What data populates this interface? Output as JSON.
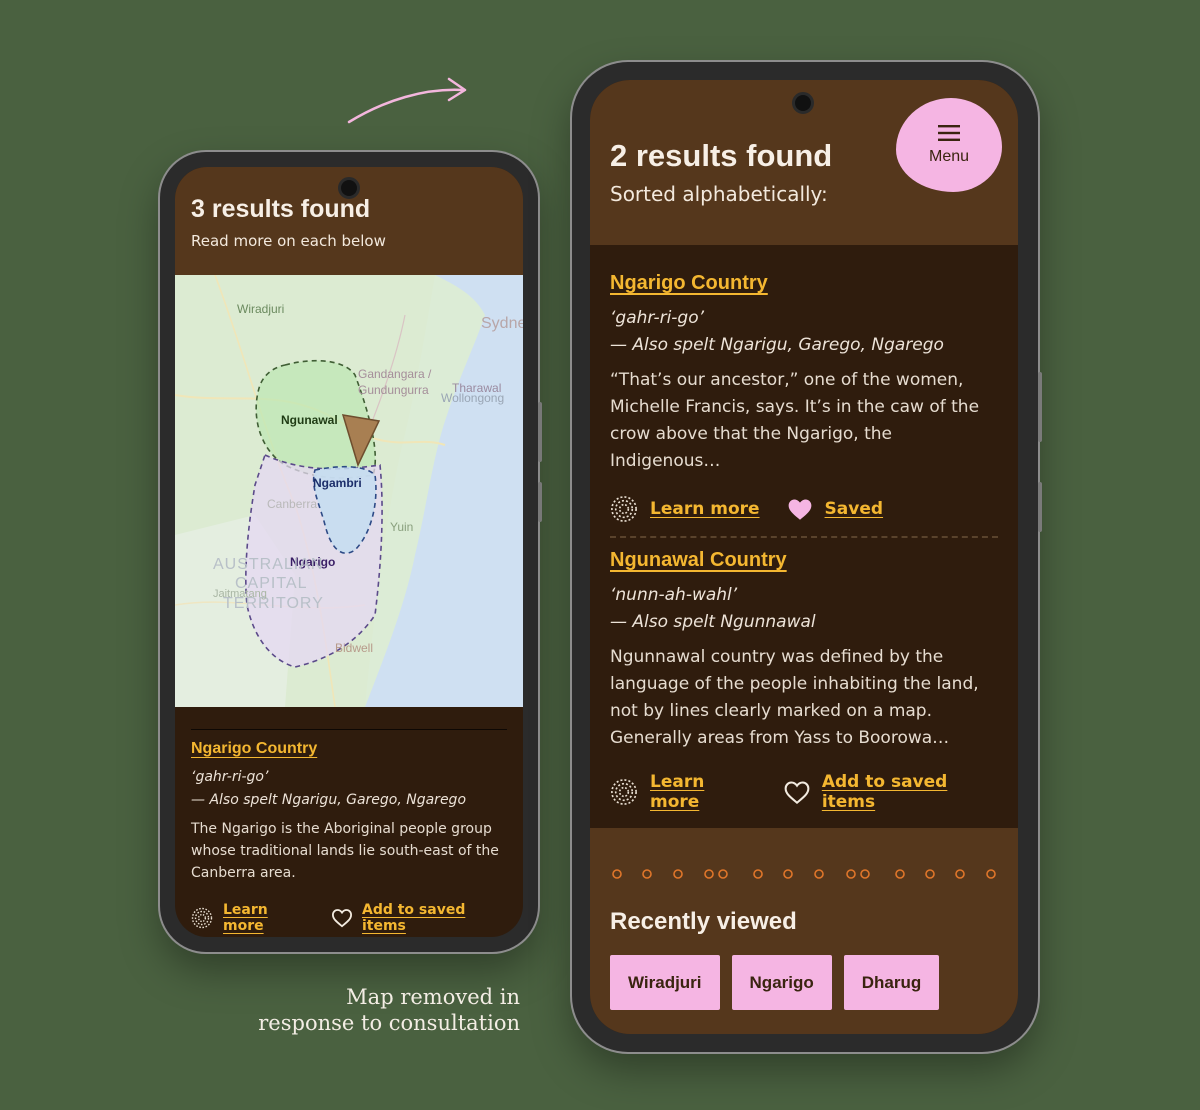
{
  "annotation": {
    "caption_line1": "Map removed in",
    "caption_line2": "response to consultation"
  },
  "left_screen": {
    "header": {
      "title": "3 results found",
      "subtitle": "Read more on each below"
    },
    "map": {
      "labels": {
        "wiradjuri": "Wiradjuri",
        "gandangara_1": "Gandangara /",
        "gandangara_2": "Gundungurra",
        "tharawal": "Tharawal",
        "wollongong": "Wollongong",
        "ngunawal": "Ngunawal",
        "ngambri": "Ngambri",
        "canberra": "Canberra",
        "yuin": "Yuin",
        "ngarigo": "Ngarigo",
        "act_1": "AUSTRALIAN",
        "act_2": "CAPITAL",
        "act_3": "TERRITORY",
        "jaitmatang": "Jaitmatang",
        "bidwell": "Bidwell",
        "sydney": "Sydney"
      }
    },
    "result": {
      "title": "Ngarigo Country",
      "pronunciation": "‘gahr-ri-go’",
      "also_spelt": "— Also spelt Ngarigu, Garego, Ngarego",
      "description": "The Ngarigo is the Aboriginal people group whose traditional lands lie south-east of the Canberra area.",
      "learn_more": "Learn more",
      "save": "Add to saved items"
    }
  },
  "right_screen": {
    "header": {
      "title": "2 results found",
      "subtitle": "Sorted alphabetically:",
      "menu_label": "Menu"
    },
    "results": [
      {
        "title": "Ngarigo Country",
        "pronunciation": "‘gahr-ri-go’",
        "also_spelt": "— Also spelt Ngarigu, Garego, Ngarego",
        "description": "“That’s our ancestor,” one of the women, Michelle Francis, says. It’s in the caw of the crow above that the Ngarigo, the Indigenous…",
        "learn_more": "Learn more",
        "save": "Saved",
        "saved": true
      },
      {
        "title": "Ngunawal Country",
        "pronunciation": "‘nunn-ah-wahl’",
        "also_spelt": "— Also spelt Ngunnawal",
        "description": "Ngunnawal country was defined by the language of the people inhabiting the land, not by lines clearly marked on a map. Generally areas from Yass to Boorowa…",
        "learn_more": "Learn more",
        "save": "Add to saved items",
        "saved": false
      }
    ],
    "recently_viewed": {
      "title": "Recently viewed",
      "items": [
        "Wiradjuri",
        "Ngarigo",
        "Dharug"
      ]
    }
  },
  "colors": {
    "background": "#4a6140",
    "header_brown": "#55371c",
    "dark_brown": "#2f1c0d",
    "link_gold": "#f4b731",
    "pink": "#f5b5e3",
    "dot_orange": "#e0762a"
  }
}
